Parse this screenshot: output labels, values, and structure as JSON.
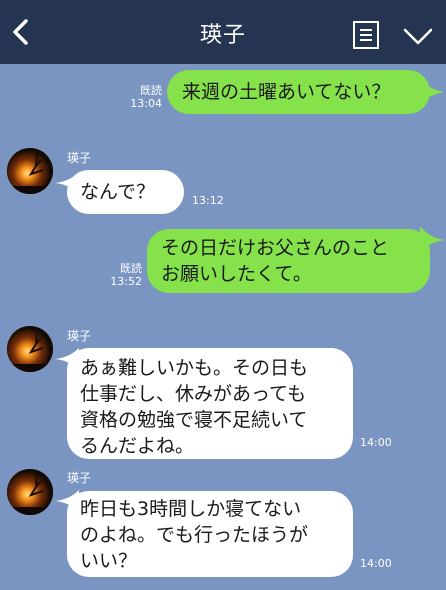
{
  "header": {
    "title": "瑛子",
    "back_icon": "chevron-left-icon",
    "notes_icon": "notes-icon",
    "menu_icon": "chevron-down-icon"
  },
  "colors": {
    "header_bg": "#243451",
    "chat_bg": "#7a95c1",
    "outgoing_bubble": "#85e24b",
    "incoming_bubble": "#ffffff"
  },
  "messages": [
    {
      "direction": "out",
      "lines": [
        "来週の土曜あいてない？"
      ],
      "read_label": "既読",
      "time": "13:04"
    },
    {
      "direction": "in",
      "sender": "瑛子",
      "lines": [
        "なんで？"
      ],
      "time": "13:12"
    },
    {
      "direction": "out",
      "lines": [
        "その日だけお父さんのこと",
        "お願いしたくて。"
      ],
      "read_label": "既読",
      "time": "13:52"
    },
    {
      "direction": "in",
      "sender": "瑛子",
      "lines": [
        "あぁ難しいかも。その日も",
        "仕事だし、休みがあっても",
        "資格の勉強で寝不足続いて",
        "るんだよね。"
      ],
      "time": "14:00"
    },
    {
      "direction": "in",
      "sender": "瑛子",
      "lines": [
        "昨日も3時間しか寝てない",
        "のよね。でも行ったほうが",
        "いい？"
      ],
      "time": "14:00"
    }
  ]
}
